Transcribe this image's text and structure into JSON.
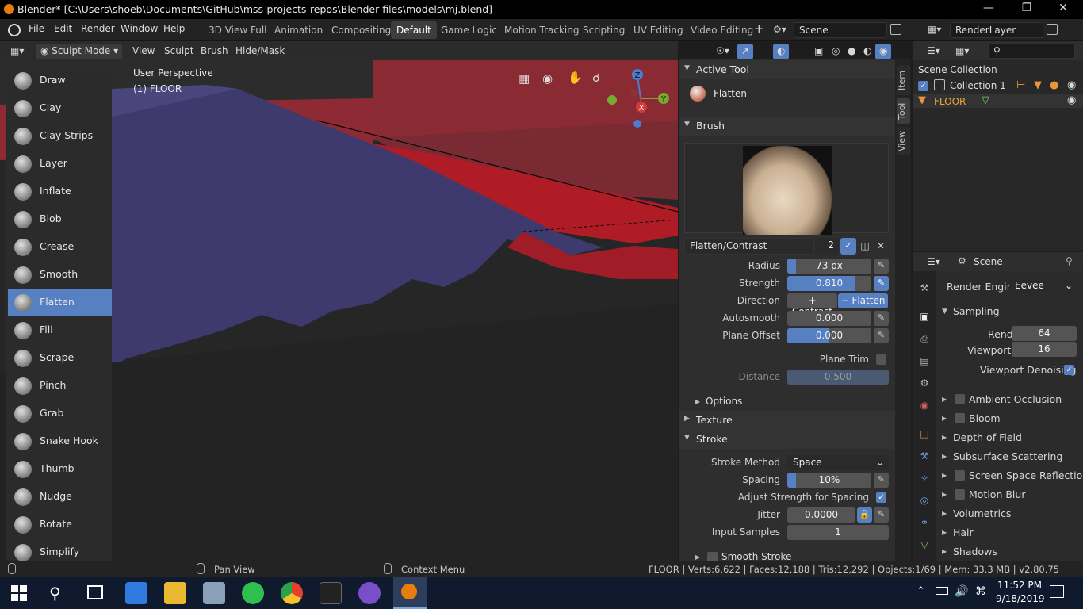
{
  "window": {
    "title": "Blender* [C:\\Users\\shoeb\\Documents\\GitHub\\mss-projects-repos\\Blender files\\models\\mj.blend]"
  },
  "menu": [
    "File",
    "Edit",
    "Render",
    "Window",
    "Help"
  ],
  "workspaces": [
    "3D View Full",
    "Animation",
    "Compositing",
    "Default",
    "Game Logic",
    "Motion Tracking",
    "Scripting",
    "UV Editing",
    "Video Editing"
  ],
  "active_workspace": "Default",
  "scene_field": "Scene",
  "renderlayer_field": "RenderLayer",
  "viewport_header": {
    "mode": "Sculpt Mode",
    "menus": [
      "View",
      "Sculpt",
      "Brush",
      "Hide/Mask"
    ]
  },
  "viewport_overlay": {
    "perspective": "User Perspective",
    "object": "(1) FLOOR"
  },
  "gizmo": {
    "x": "X",
    "y": "Y",
    "z": "Z"
  },
  "tools": [
    "Draw",
    "Clay",
    "Clay Strips",
    "Layer",
    "Inflate",
    "Blob",
    "Crease",
    "Smooth",
    "Flatten",
    "Fill",
    "Scrape",
    "Pinch",
    "Grab",
    "Snake Hook",
    "Thumb",
    "Nudge",
    "Rotate",
    "Simplify"
  ],
  "active_tool_name": "Flatten",
  "active_tool_panel": {
    "header": "Active Tool",
    "tool": "Flatten"
  },
  "brush_panel": {
    "header": "Brush",
    "brush_name": "Flatten/Contrast",
    "users": "2",
    "radius_label": "Radius",
    "radius": "73 px",
    "radius_fill": 0.1,
    "strength_label": "Strength",
    "strength": "0.810",
    "strength_fill": 0.81,
    "direction_label": "Direction",
    "dir_contrast": "Contrast",
    "dir_flatten": "Flatten",
    "autosmooth_label": "Autosmooth",
    "autosmooth": "0.000",
    "plane_offset_label": "Plane Offset",
    "plane_offset": "0.000",
    "plane_offset_fill": 0.5,
    "plane_trim_label": "Plane Trim",
    "distance_label": "Distance",
    "distance": "0.500",
    "options": "Options"
  },
  "texture_panel": "Texture",
  "stroke_panel": {
    "header": "Stroke",
    "method_label": "Stroke Method",
    "method": "Space",
    "spacing_label": "Spacing",
    "spacing": "10%",
    "spacing_fill": 0.1,
    "adjust_label": "Adjust Strength for Spacing",
    "jitter_label": "Jitter",
    "jitter": "0.0000",
    "input_samples_label": "Input Samples",
    "input_samples": "1",
    "smooth_stroke": "Smooth Stroke"
  },
  "side_tabs": [
    "Item",
    "Tool",
    "View"
  ],
  "outliner": {
    "root": "Scene Collection",
    "collection": "Collection 1",
    "object": "FLOOR"
  },
  "render_props": {
    "context": "Scene",
    "engine_label": "Render Engine",
    "engine": "Eevee",
    "sampling": "Sampling",
    "render_label": "Render",
    "render_samples": "64",
    "viewport_label": "Viewport",
    "viewport_samples": "16",
    "denoise_label": "Viewport Denoising",
    "panels": [
      "Ambient Occlusion",
      "Bloom",
      "Depth of Field",
      "Subsurface Scattering",
      "Screen Space Reflections",
      "Motion Blur",
      "Volumetrics",
      "Hair",
      "Shadows"
    ]
  },
  "statusbar": {
    "pan": "Pan View",
    "context": "Context Menu",
    "stats": "FLOOR | Verts:6,622 | Faces:12,188 | Tris:12,292 | Objects:1/69 | Mem: 33.3 MB | v2.80.75"
  },
  "taskbar": {
    "time": "11:52 PM",
    "date": "9/18/2019"
  },
  "colors": {
    "accent": "#5680c2",
    "floor_red": "#b01c26",
    "floor_purple": "#3e3a6e"
  }
}
